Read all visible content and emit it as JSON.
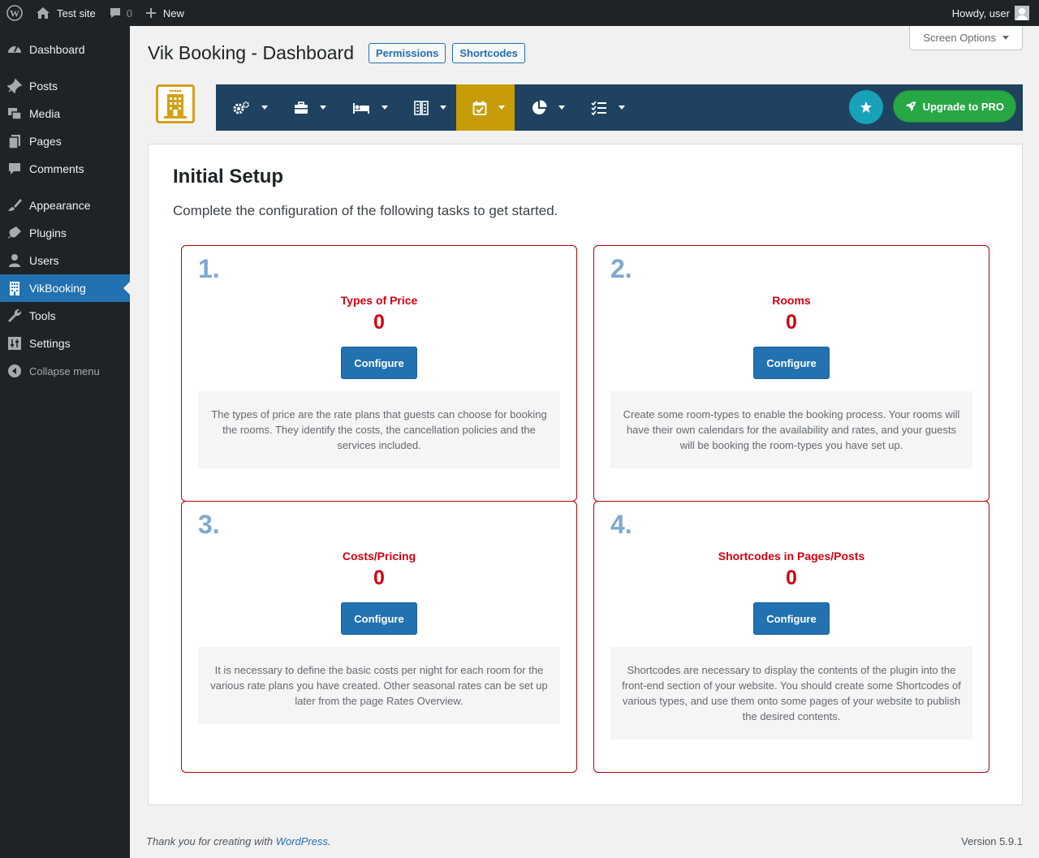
{
  "adminbar": {
    "site_name": "Test site",
    "comments_count": "0",
    "new_label": "New",
    "greeting": "Howdy, user"
  },
  "sidebar": {
    "items": [
      {
        "label": "Dashboard",
        "icon": "dashboard-icon"
      },
      {
        "label": "Posts",
        "icon": "pin-icon"
      },
      {
        "label": "Media",
        "icon": "media-icon"
      },
      {
        "label": "Pages",
        "icon": "pages-icon"
      },
      {
        "label": "Comments",
        "icon": "comment-icon"
      },
      {
        "label": "Appearance",
        "icon": "brush-icon"
      },
      {
        "label": "Plugins",
        "icon": "plug-icon"
      },
      {
        "label": "Users",
        "icon": "user-icon"
      },
      {
        "label": "VikBooking",
        "icon": "building-icon"
      },
      {
        "label": "Tools",
        "icon": "wrench-icon"
      },
      {
        "label": "Settings",
        "icon": "sliders-icon"
      }
    ],
    "collapse_label": "Collapse menu"
  },
  "header": {
    "screen_options": "Screen Options",
    "title": "Vik Booking - Dashboard",
    "permissions_label": "Permissions",
    "shortcodes_label": "Shortcodes"
  },
  "toolbar": {
    "items": [
      "gears-icon",
      "briefcase-icon",
      "bed-icon",
      "columns-icon",
      "calendar-check-icon",
      "pie-chart-icon",
      "checklist-icon"
    ],
    "active_index": 4,
    "upgrade_label": "Upgrade to PRO"
  },
  "setup": {
    "title": "Initial Setup",
    "subtitle": "Complete the configuration of the following tasks to get started.",
    "configure_label": "Configure",
    "cards": [
      {
        "num": "1.",
        "title": "Types of Price",
        "count": "0",
        "desc": "The types of price are the rate plans that guests can choose for booking the rooms. They identify the costs, the cancellation policies and the services included."
      },
      {
        "num": "2.",
        "title": "Rooms",
        "count": "0",
        "desc": "Create some room-types to enable the booking process. Your rooms will have their own calendars for the availability and rates, and your guests will be booking the room-types you have set up."
      },
      {
        "num": "3.",
        "title": "Costs/Pricing",
        "count": "0",
        "desc": "It is necessary to define the basic costs per night for each room for the various rate plans you have created. Other seasonal rates can be set up later from the page Rates Overview."
      },
      {
        "num": "4.",
        "title": "Shortcodes in Pages/Posts",
        "count": "0",
        "desc": "Shortcodes are necessary to display the contents of the plugin into the front-end section of your website. You should create some Shortcodes of various types, and use them onto some pages of your website to publish the desired contents."
      }
    ]
  },
  "footer": {
    "thanks_prefix": "Thank you for creating with",
    "wordpress_link": "WordPress",
    "thanks_suffix": ".",
    "version": "Version 5.9.1"
  }
}
